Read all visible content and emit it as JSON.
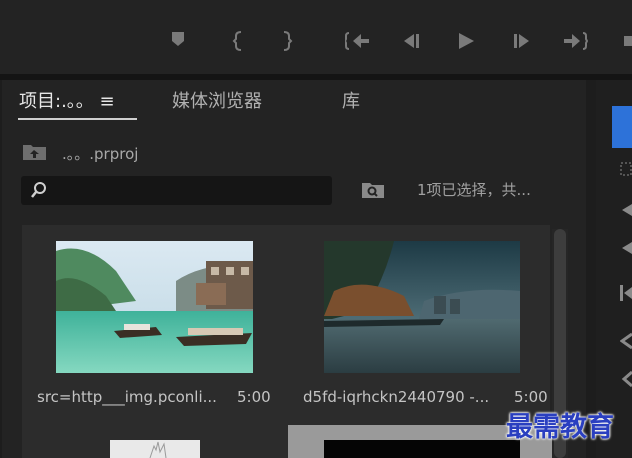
{
  "tabs": [
    {
      "label": "项目:.。。 ≡"
    },
    {
      "label": "媒体浏览器"
    },
    {
      "label": "库"
    }
  ],
  "breadcrumb": {
    "project_name": ".。。.prproj"
  },
  "search": {
    "placeholder": ""
  },
  "status_text": "1项已选择，共...",
  "media_items": [
    {
      "name": "src=http___img.pconli...",
      "duration": "5:00",
      "thumbnail": "riverside-village-boats"
    },
    {
      "name": "d5fd-iqrhckn2440790 -...",
      "duration": "5:00",
      "thumbnail": "misty-river-town"
    },
    {
      "name": "",
      "duration": "",
      "thumbnail": "white-frame"
    },
    {
      "name": "",
      "duration": "",
      "thumbnail": "black-frame-selected"
    }
  ],
  "watermark": "最需教育",
  "icons": {
    "marker": "marker-icon",
    "in_point": "mark-in-icon",
    "out_point": "mark-out-icon",
    "go_to_in": "go-to-in-icon",
    "step_back": "step-back-icon",
    "play": "play-icon",
    "step_forward": "step-forward-icon",
    "go_to_out": "go-to-out-icon",
    "folder_up": "folder-up-icon",
    "search": "search-icon",
    "new_bin": "new-bin-icon"
  }
}
